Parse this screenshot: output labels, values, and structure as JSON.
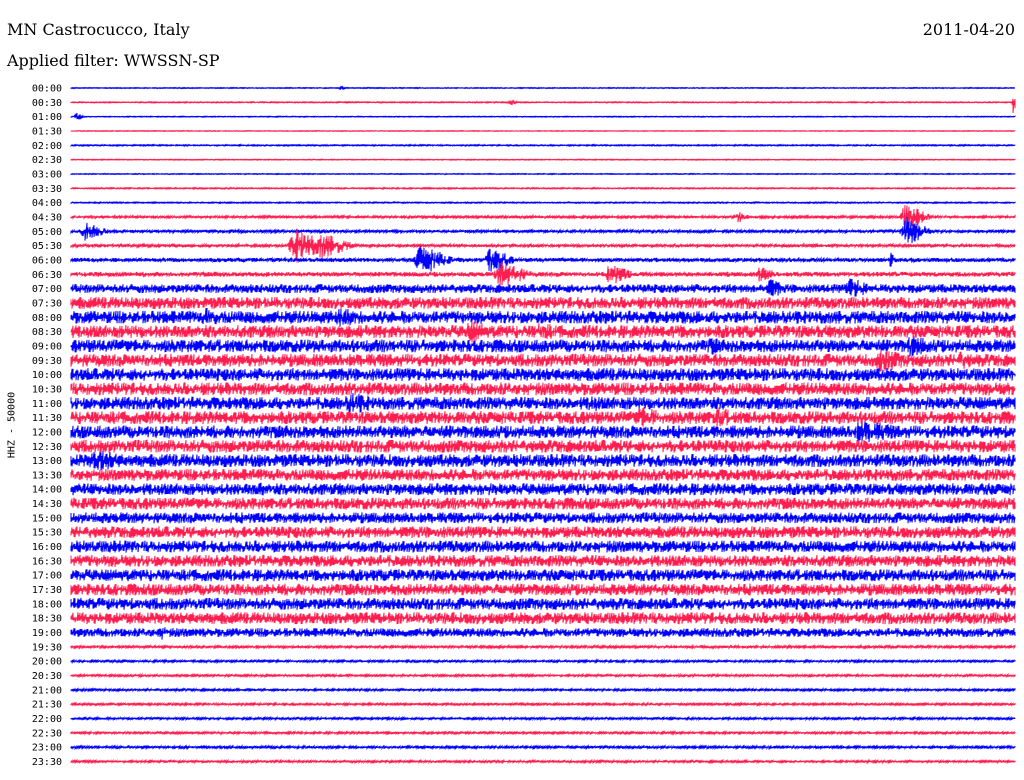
{
  "header": {
    "station": "MN Castrocucco, Italy",
    "date": "2011-04-20",
    "filter": "Applied filter: WWSSN-SP"
  },
  "chart_data": {
    "type": "line",
    "title": "MN Castrocucco, Italy",
    "ylabel": "HHZ - 50000",
    "colors": [
      "#0000ff",
      "#ff1e50"
    ],
    "rows": [
      {
        "label": "00:00",
        "noise": 0.4
      },
      {
        "label": "00:30",
        "noise": 0.5
      },
      {
        "label": "01:00",
        "noise": 0.4
      },
      {
        "label": "01:30",
        "noise": 0.3
      },
      {
        "label": "02:00",
        "noise": 0.6
      },
      {
        "label": "02:30",
        "noise": 0.4
      },
      {
        "label": "03:00",
        "noise": 0.4
      },
      {
        "label": "03:30",
        "noise": 0.6
      },
      {
        "label": "04:00",
        "noise": 0.6
      },
      {
        "label": "04:30",
        "noise": 1.2
      },
      {
        "label": "05:00",
        "noise": 1.4
      },
      {
        "label": "05:30",
        "noise": 1.4
      },
      {
        "label": "06:00",
        "noise": 2.0
      },
      {
        "label": "06:30",
        "noise": 2.4
      },
      {
        "label": "07:00",
        "noise": 4.5
      },
      {
        "label": "07:30",
        "noise": 6.0
      },
      {
        "label": "08:00",
        "noise": 6.5
      },
      {
        "label": "08:30",
        "noise": 6.5
      },
      {
        "label": "09:00",
        "noise": 6.5
      },
      {
        "label": "09:30",
        "noise": 6.5
      },
      {
        "label": "10:00",
        "noise": 6.5
      },
      {
        "label": "10:30",
        "noise": 6.5
      },
      {
        "label": "11:00",
        "noise": 6.5
      },
      {
        "label": "11:30",
        "noise": 6.5
      },
      {
        "label": "12:00",
        "noise": 6.5
      },
      {
        "label": "12:30",
        "noise": 6.5
      },
      {
        "label": "13:00",
        "noise": 6.5
      },
      {
        "label": "13:30",
        "noise": 6.0
      },
      {
        "label": "14:00",
        "noise": 6.0
      },
      {
        "label": "14:30",
        "noise": 6.0
      },
      {
        "label": "15:00",
        "noise": 5.5
      },
      {
        "label": "15:30",
        "noise": 6.0
      },
      {
        "label": "16:00",
        "noise": 6.0
      },
      {
        "label": "16:30",
        "noise": 6.0
      },
      {
        "label": "17:00",
        "noise": 6.0
      },
      {
        "label": "17:30",
        "noise": 6.0
      },
      {
        "label": "18:00",
        "noise": 6.0
      },
      {
        "label": "18:30",
        "noise": 6.0
      },
      {
        "label": "19:00",
        "noise": 4.5
      },
      {
        "label": "19:30",
        "noise": 1.2
      },
      {
        "label": "20:00",
        "noise": 1.0
      },
      {
        "label": "20:30",
        "noise": 1.0
      },
      {
        "label": "21:00",
        "noise": 1.0
      },
      {
        "label": "21:30",
        "noise": 1.0
      },
      {
        "label": "22:00",
        "noise": 1.0
      },
      {
        "label": "22:30",
        "noise": 1.0
      },
      {
        "label": "23:00",
        "noise": 1.2
      },
      {
        "label": "23:30",
        "noise": 1.0
      }
    ]
  }
}
